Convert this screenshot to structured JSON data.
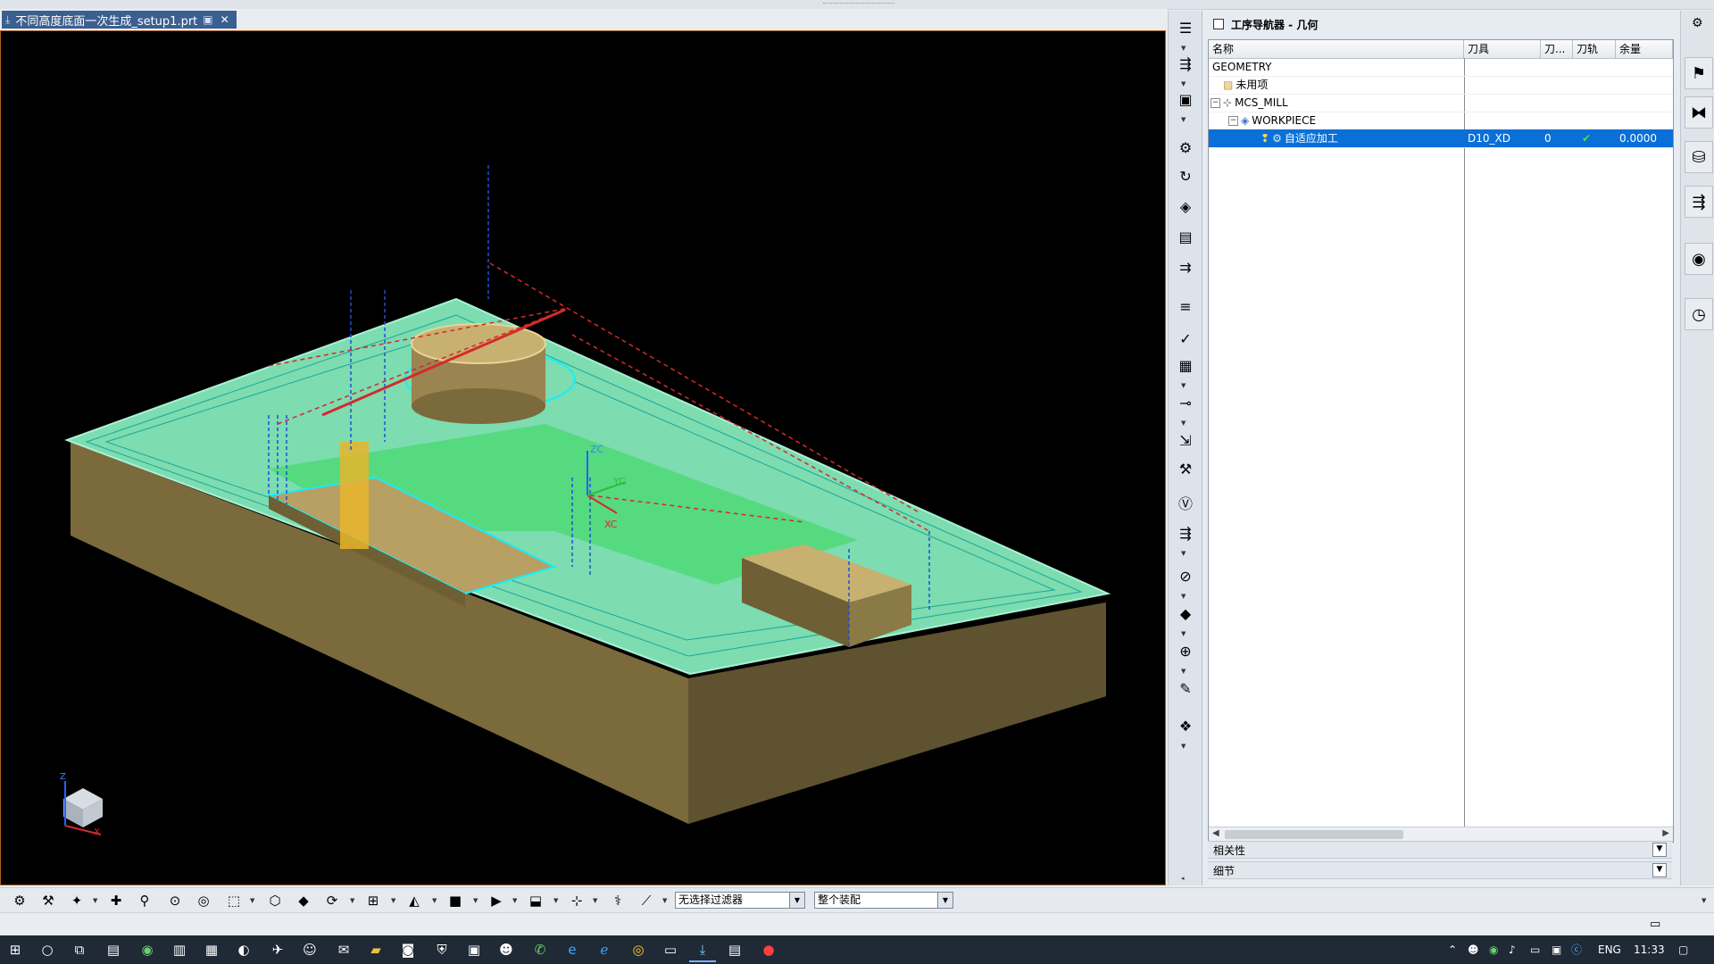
{
  "document": {
    "tab_title": "不同高度底面一次生成_setup1.prt",
    "close_glyph": "✕"
  },
  "viewport": {
    "axis_labels": {
      "zc": "ZC",
      "yc": "YC",
      "xc": "XC"
    },
    "triad_labels": {
      "z": "Z",
      "x": "X"
    },
    "colors": {
      "background": "#000000",
      "part": "#8a7a46",
      "toolpath_cut": "#6fe1b0",
      "toolpath_engage": "#1f4fd6",
      "toolpath_rapid": "#d42a2a",
      "pillar": "#e8b52a"
    }
  },
  "navigator": {
    "title": "工序导航器 - 几何",
    "columns": [
      "名称",
      "刀具",
      "刀...",
      "刀轨",
      "余量"
    ],
    "rows": [
      {
        "name": "GEOMETRY",
        "tool": "",
        "num": "",
        "path": "",
        "stock": "",
        "level": 0,
        "icon": "",
        "expander": ""
      },
      {
        "name": "未用项",
        "tool": "",
        "num": "",
        "path": "",
        "stock": "",
        "level": 1,
        "icon": "folder-icon",
        "expander": ""
      },
      {
        "name": "MCS_MILL",
        "tool": "",
        "num": "",
        "path": "",
        "stock": "",
        "level": 1,
        "icon": "mcs-icon",
        "expander": "⊟"
      },
      {
        "name": "WORKPIECE",
        "tool": "",
        "num": "",
        "path": "",
        "stock": "",
        "level": 2,
        "icon": "workpiece-icon",
        "expander": "⊟"
      },
      {
        "name": "自适应加工",
        "tool": "D10_XD",
        "num": "0",
        "path": "✔",
        "stock": "0.0000",
        "level": 3,
        "icon": "operation-icon",
        "expander": "",
        "selected": true
      }
    ],
    "sections": [
      "相关性",
      "细节"
    ],
    "accent": "#0a6fd6"
  },
  "bottom_toolbar": {
    "filter_combo": "无选择过滤器",
    "scope_combo": "整个装配"
  },
  "taskbar": {
    "lang": "ENG",
    "time": "11:33"
  }
}
